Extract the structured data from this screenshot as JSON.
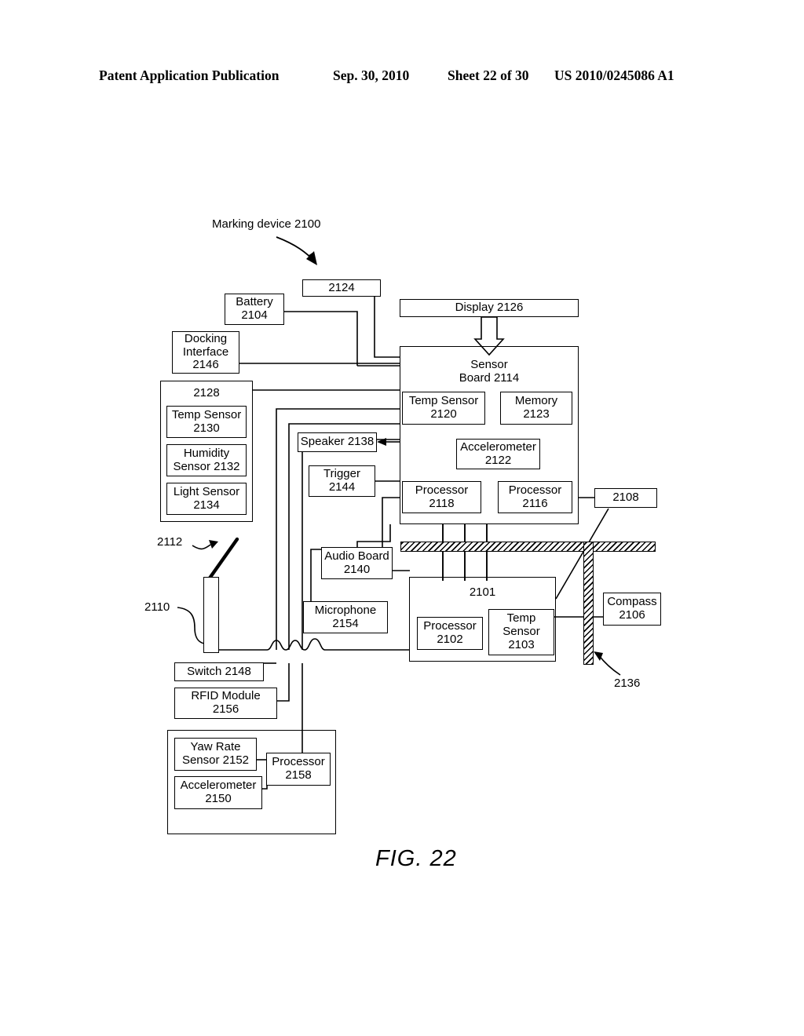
{
  "header": {
    "publication": "Patent Application Publication",
    "date": "Sep. 30, 2010",
    "sheet": "Sheet 22 of 30",
    "number": "US 2010/0245086 A1"
  },
  "figure": {
    "caption": "FIG. 22",
    "title_label": "Marking device 2100"
  },
  "callouts": {
    "c2112": "2112",
    "c2110": "2110",
    "c2136": "2136"
  },
  "blocks": {
    "battery": {
      "l1": "Battery",
      "l2": "2104"
    },
    "b2124": {
      "l1": "2124"
    },
    "display": {
      "l1": "Display 2126"
    },
    "docking": {
      "l1": "Docking",
      "l2": "Interface",
      "l3": "2146"
    },
    "sensor_board": {
      "l1": "Sensor",
      "l2": "Board 2114"
    },
    "temp_2120": {
      "l1": "Temp Sensor",
      "l2": "2120"
    },
    "memory_2123": {
      "l1": "Memory",
      "l2": "2123"
    },
    "accel_2122": {
      "l1": "Accelerometer",
      "l2": "2122"
    },
    "proc_2118": {
      "l1": "Processor",
      "l2": "2118"
    },
    "proc_2116": {
      "l1": "Processor",
      "l2": "2116"
    },
    "b2128": {
      "l1": "2128"
    },
    "temp_2130": {
      "l1": "Temp Sensor",
      "l2": "2130"
    },
    "humidity_2132": {
      "l1": "Humidity",
      "l2": "Sensor 2132"
    },
    "light_2134": {
      "l1": "Light Sensor",
      "l2": "2134"
    },
    "speaker_2138": {
      "l1": "Speaker 2138"
    },
    "trigger_2144": {
      "l1": "Trigger",
      "l2": "2144"
    },
    "audio_2140": {
      "l1": "Audio Board",
      "l2": "2140"
    },
    "microphone_2154": {
      "l1": "Microphone",
      "l2": "2154"
    },
    "b2108": {
      "l1": "2108"
    },
    "b2101": {
      "l1": "2101"
    },
    "proc_2102": {
      "l1": "Processor",
      "l2": "2102"
    },
    "temp_2103": {
      "l1": "Temp",
      "l2": "Sensor",
      "l3": "2103"
    },
    "compass_2106": {
      "l1": "Compass",
      "l2": "2106"
    },
    "switch_2148": {
      "l1": "Switch 2148"
    },
    "rfid_2156": {
      "l1": "RFID Module",
      "l2": "2156"
    },
    "yaw_2152": {
      "l1": "Yaw Rate",
      "l2": "Sensor 2152"
    },
    "accel_2150": {
      "l1": "Accelerometer",
      "l2": "2150"
    },
    "proc_2158": {
      "l1": "Processor",
      "l2": "2158"
    }
  }
}
